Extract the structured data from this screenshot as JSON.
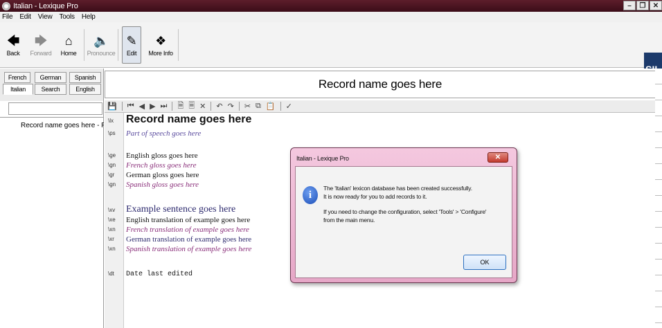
{
  "window": {
    "title": "Italian - Lexique Pro"
  },
  "menu": [
    "File",
    "Edit",
    "View",
    "Tools",
    "Help"
  ],
  "toolbar": {
    "back": "Back",
    "forward": "Forward",
    "home": "Home",
    "pronounce": "Pronounce",
    "edit": "Edit",
    "more_info": "More Info"
  },
  "language_tabs": [
    "French",
    "German",
    "Spanish",
    "Italian",
    "Search",
    "English"
  ],
  "record_list": {
    "items": [
      "Record name goes here - Pa"
    ]
  },
  "record_header": "Record name goes here",
  "markers": [
    "\\lx",
    "\\ps",
    "\\ge",
    "\\gn",
    "\\gr",
    "\\gn",
    "\\xv",
    "\\xe",
    "\\xn",
    "\\xr",
    "\\xn",
    "\\dt"
  ],
  "entry": {
    "lx": "Record name goes here",
    "ps": "Part of speech goes here",
    "ge": "English gloss goes here",
    "gn": "French gloss goes here",
    "gr": "German gloss goes here",
    "gs": "Spanish gloss goes here",
    "xv": "Example sentence goes here",
    "xe": "English translation of example goes here",
    "xn": "French translation of example goes here",
    "xr": "German translation of example goes here",
    "xs": "Spanish translation of example goes here",
    "dt": "Date last edited"
  },
  "dialog": {
    "title": "Italian - Lexique Pro",
    "line1": "The 'Italian' lexicon database has been created successfully.",
    "line2": "It is now ready for you to add records to it.",
    "line3": "If you need to change the configuration, select 'Tools' > 'Configure'",
    "line4": "from the main menu.",
    "ok": "OK"
  },
  "logo_text": "SIL"
}
